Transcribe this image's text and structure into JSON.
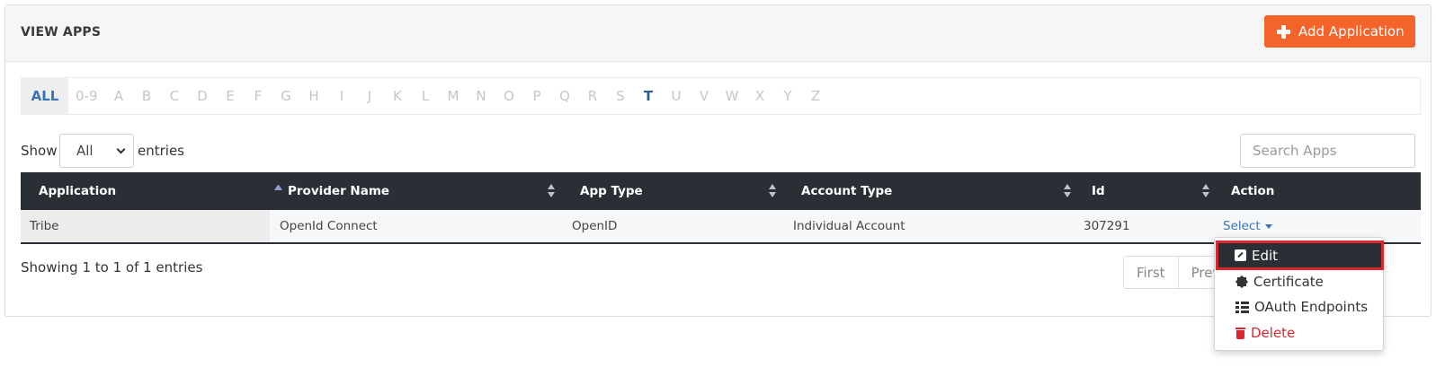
{
  "header": {
    "title": "VIEW APPS",
    "add_button_label": "Add Application",
    "add_button_color": "#f4642a"
  },
  "alphabet": [
    "ALL",
    "0-9",
    "A",
    "B",
    "C",
    "D",
    "E",
    "F",
    "G",
    "H",
    "I",
    "J",
    "K",
    "L",
    "M",
    "N",
    "O",
    "P",
    "Q",
    "R",
    "S",
    "T",
    "U",
    "V",
    "W",
    "X",
    "Y",
    "Z"
  ],
  "alphabet_selected": "ALL",
  "alphabet_highlighted": "T",
  "controls": {
    "show_label": "Show",
    "show_value": "All",
    "entries_label": "entries",
    "search_placeholder": "Search Apps"
  },
  "table": {
    "columns": [
      "Application",
      "Provider Name",
      "App Type",
      "Account Type",
      "Id",
      "Action"
    ],
    "rows": [
      {
        "application": "Tribe",
        "provider_name": "OpenId Connect",
        "app_type": "OpenID",
        "account_type": "Individual Account",
        "id": "307291",
        "action": "Select"
      }
    ]
  },
  "footer": {
    "info": "Showing 1 to 1 of 1 entries",
    "pager": [
      "First",
      "Prev"
    ]
  },
  "action_menu": {
    "items": [
      {
        "label": "Edit",
        "icon": "edit-icon"
      },
      {
        "label": "Certificate",
        "icon": "certificate-icon"
      },
      {
        "label": "OAuth Endpoints",
        "icon": "list-icon"
      },
      {
        "label": "Delete",
        "icon": "trash-icon"
      }
    ]
  },
  "colors": {
    "header_dark": "#2a2f36",
    "link_blue": "#3a73b3",
    "danger_red": "#d9282f"
  }
}
